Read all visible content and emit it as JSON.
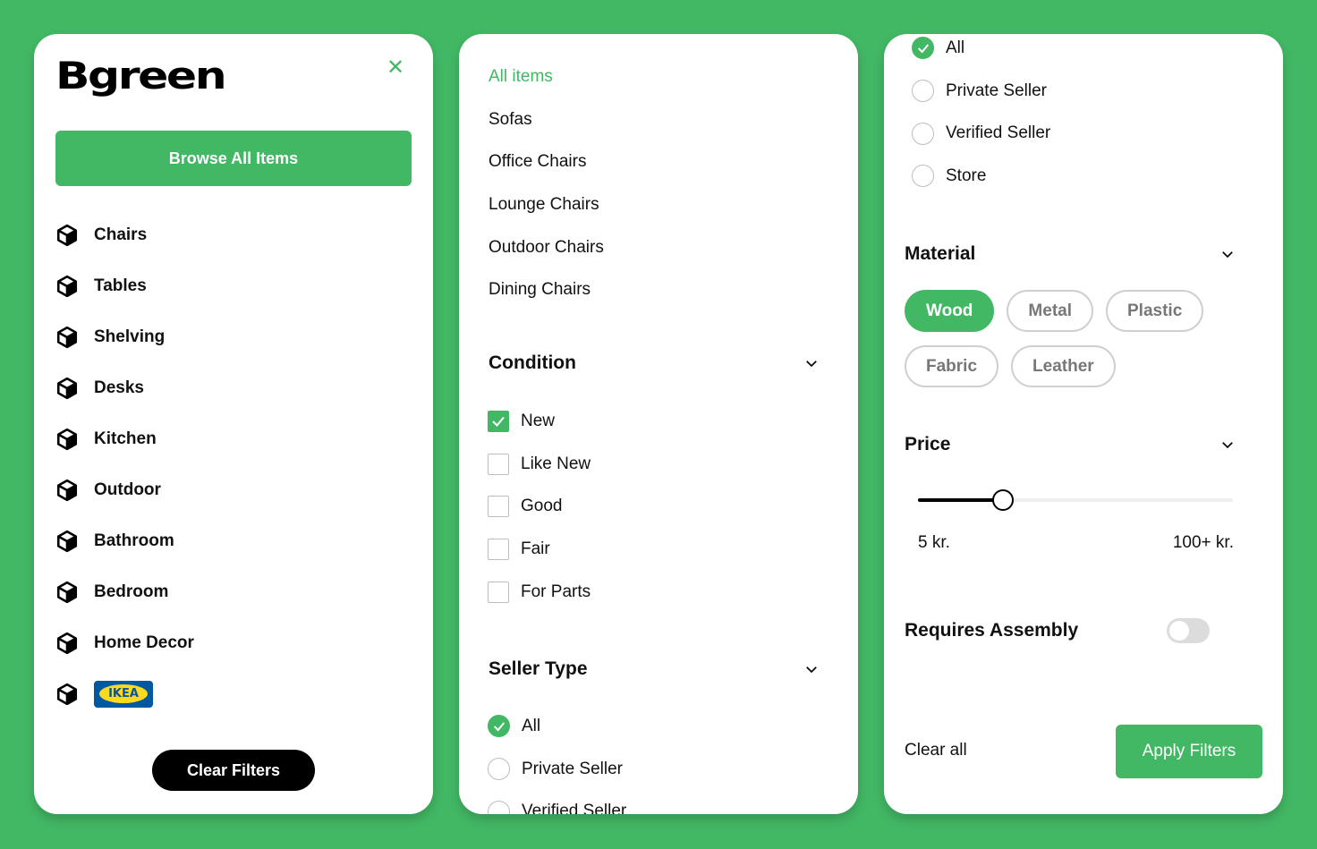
{
  "brand": {
    "logo_text": "Bgreen"
  },
  "sidebar": {
    "browse_label": "Browse All Items",
    "categories": [
      {
        "label": "Chairs"
      },
      {
        "label": "Tables"
      },
      {
        "label": "Shelving"
      },
      {
        "label": "Desks"
      },
      {
        "label": "Kitchen"
      },
      {
        "label": "Outdoor"
      },
      {
        "label": "Bathroom"
      },
      {
        "label": "Bedroom"
      },
      {
        "label": "Home Decor"
      },
      {
        "label": "IKEA"
      }
    ],
    "clear_filters_label": "Clear Filters"
  },
  "subcategories": {
    "items": [
      "All items",
      "Sofas",
      "Office Chairs",
      "Lounge Chairs",
      "Outdoor Chairs",
      "Dining Chairs"
    ],
    "active": "All items"
  },
  "condition": {
    "title": "Condition",
    "options": [
      {
        "label": "New",
        "checked": true
      },
      {
        "label": "Like New",
        "checked": false
      },
      {
        "label": "Good",
        "checked": false
      },
      {
        "label": "Fair",
        "checked": false
      },
      {
        "label": "For Parts",
        "checked": false
      }
    ]
  },
  "seller_type": {
    "title": "Seller Type",
    "options": [
      {
        "label": "All",
        "checked": true
      },
      {
        "label": "Private Seller",
        "checked": false
      },
      {
        "label": "Verified Seller",
        "checked": false
      },
      {
        "label": "Store",
        "checked": false
      }
    ]
  },
  "material": {
    "title": "Material",
    "chips": [
      {
        "label": "Wood",
        "selected": true
      },
      {
        "label": "Metal",
        "selected": false
      },
      {
        "label": "Plastic",
        "selected": false
      },
      {
        "label": "Fabric",
        "selected": false
      },
      {
        "label": "Leather",
        "selected": false
      }
    ]
  },
  "price": {
    "title": "Price",
    "min_label": "5 kr.",
    "max_label": "100+ kr.",
    "slider_fraction": 0.27
  },
  "assembly": {
    "label": "Requires Assembly",
    "enabled": false
  },
  "footer": {
    "clear_all_label": "Clear all",
    "apply_label": "Apply Filters"
  },
  "colors": {
    "accent": "#42b864",
    "ikea_blue": "#0058a3",
    "ikea_yellow": "#ffda1a"
  }
}
